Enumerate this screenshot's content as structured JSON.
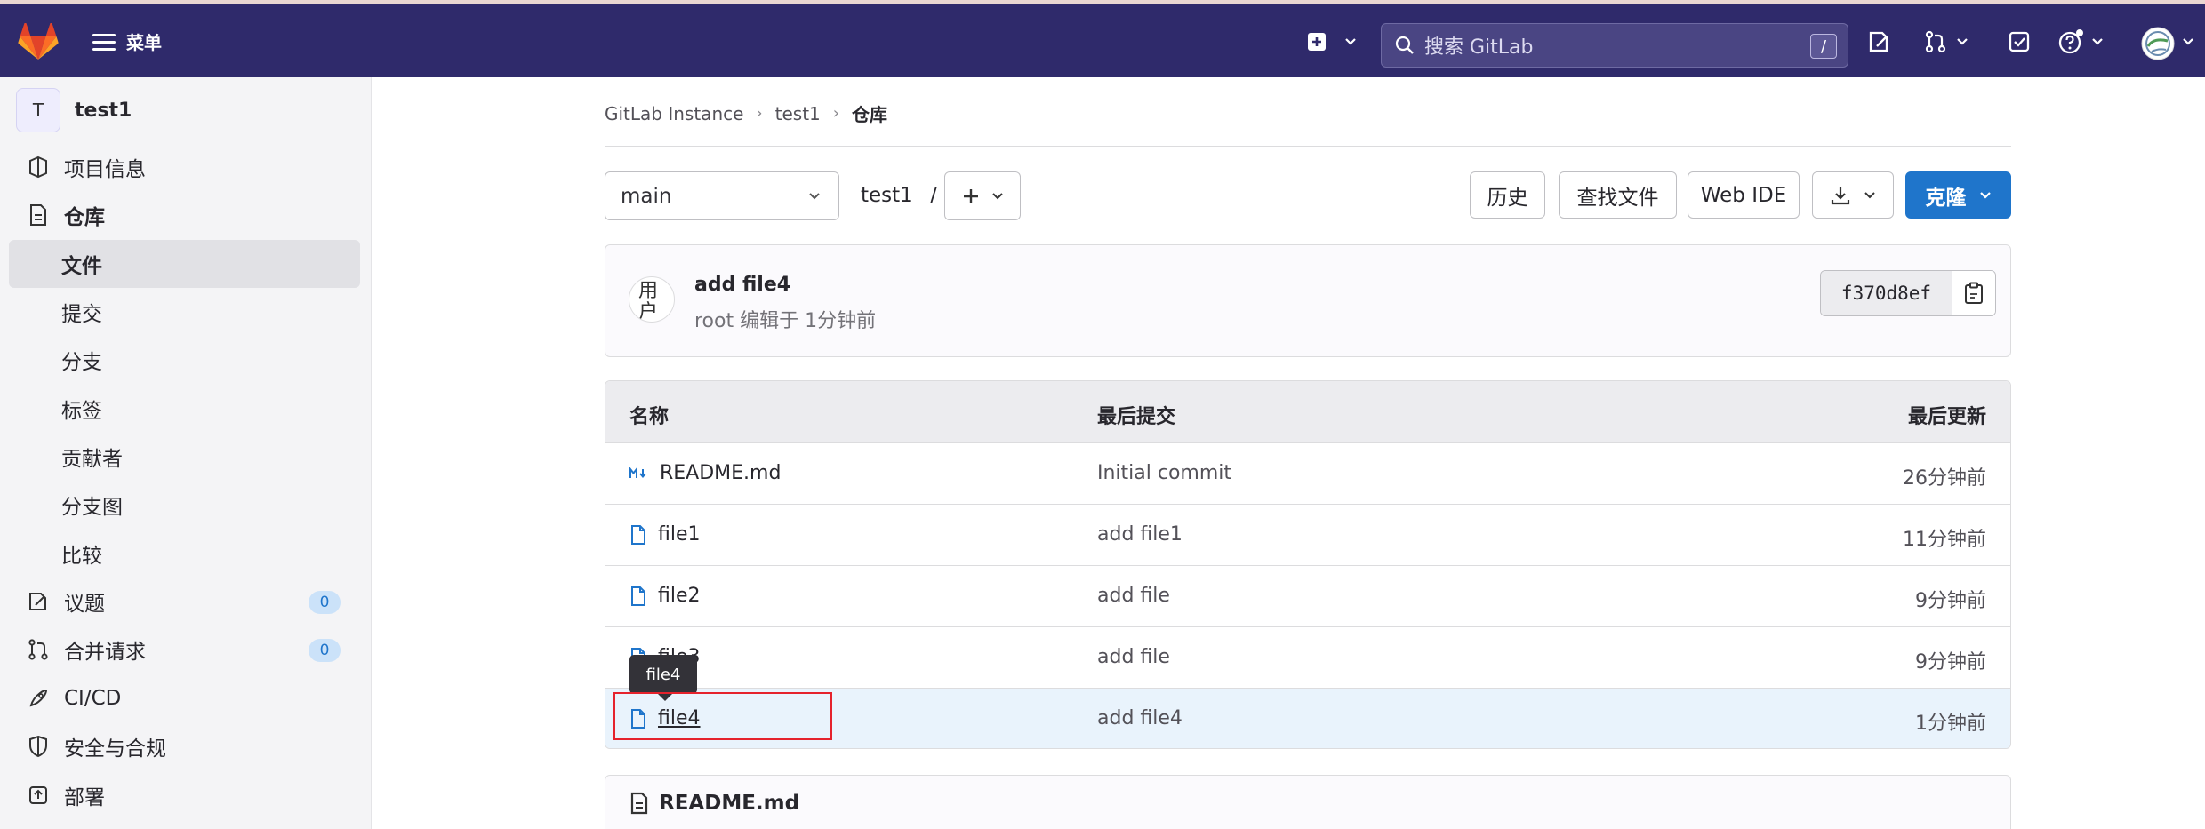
{
  "navbar": {
    "menu_label": "菜单",
    "search_placeholder": "搜索 GitLab",
    "search_shortcut": "/",
    "icons": [
      "gitlab-logo",
      "plus-square-icon",
      "issues-icon",
      "merge-request-icon",
      "todo-icon",
      "help-icon",
      "user-avatar"
    ],
    "bg_color": "#2f2a6b"
  },
  "sidebar": {
    "project_initial": "T",
    "project_name": "test1",
    "items": [
      {
        "label": "项目信息",
        "icon": "info-icon"
      },
      {
        "label": "仓库",
        "icon": "document-icon"
      },
      {
        "label": "文件"
      },
      {
        "label": "提交"
      },
      {
        "label": "分支"
      },
      {
        "label": "标签"
      },
      {
        "label": "贡献者"
      },
      {
        "label": "分支图"
      },
      {
        "label": "比较"
      },
      {
        "label": "议题",
        "icon": "issues-icon",
        "count": "0"
      },
      {
        "label": "合并请求",
        "icon": "merge-request-icon",
        "count": "0"
      },
      {
        "label": "CI/CD",
        "icon": "rocket-icon"
      },
      {
        "label": "安全与合规",
        "icon": "shield-icon"
      },
      {
        "label": "部署",
        "icon": "deploy-icon"
      }
    ]
  },
  "breadcrumb": [
    "GitLab Instance",
    "test1",
    "仓库"
  ],
  "toolbar": {
    "branch": "main",
    "path_root": "test1",
    "path_sep": "/",
    "history": "历史",
    "find_file": "查找文件",
    "web_ide": "Web IDE",
    "clone": "克隆"
  },
  "commit": {
    "avatar_alt": "用户头像",
    "title": "add file4",
    "meta": "root 编辑于 1分钟前",
    "sha": "f370d8ef"
  },
  "files": {
    "headers": [
      "名称",
      "最后提交",
      "最后更新"
    ],
    "rows": [
      {
        "name": "README.md",
        "commit": "Initial commit",
        "updated": "26分钟前",
        "icon": "markdown-icon"
      },
      {
        "name": "file1",
        "commit": "add file1",
        "updated": "11分钟前",
        "icon": "file-icon"
      },
      {
        "name": "file2",
        "commit": "add file",
        "updated": "9分钟前",
        "icon": "file-icon"
      },
      {
        "name": "file3",
        "commit": "add file",
        "updated": "9分钟前",
        "icon": "file-icon"
      },
      {
        "name": "file4",
        "commit": "add file4",
        "updated": "1分钟前",
        "icon": "file-icon"
      }
    ]
  },
  "tooltip": "file4",
  "readme": {
    "title": "README.md"
  },
  "colors": {
    "accent": "#1f75cb",
    "highlight_row": "#e9f3fc",
    "annotation": "#e5222c"
  }
}
